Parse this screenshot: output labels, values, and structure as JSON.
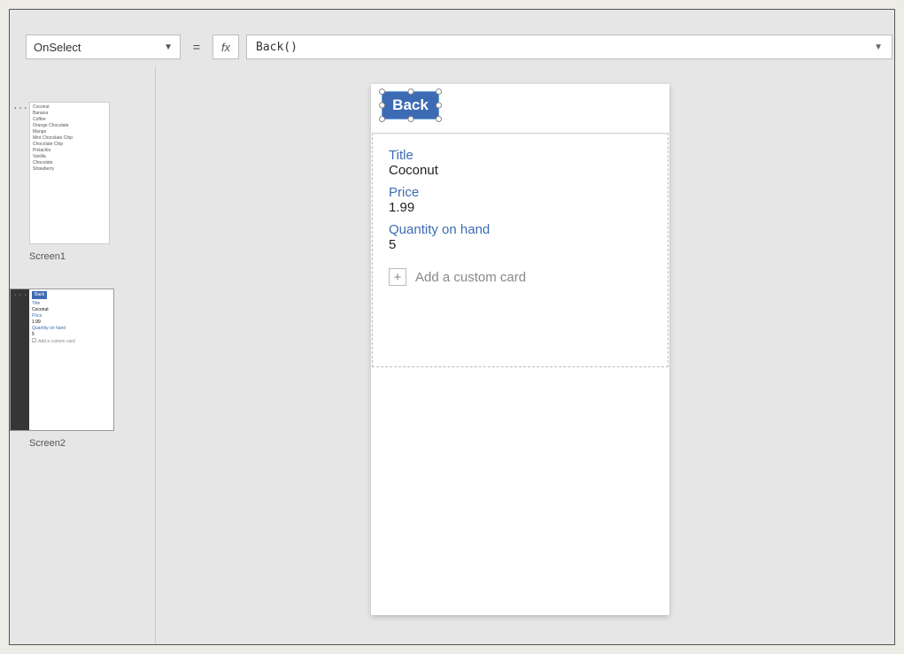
{
  "formula_bar": {
    "property": "OnSelect",
    "equals": "=",
    "fx": "fx",
    "formula": "Back()"
  },
  "thumbnails": {
    "screen1": {
      "label": "Screen1",
      "list": [
        "Coconut",
        "Banana",
        "Coffee",
        "Orange Chocolate",
        "Mango",
        "Mint Chocolate Chip",
        "Chocolate Chip",
        "Pistachio",
        "Vanilla",
        "Chocolate",
        "Strawberry"
      ]
    },
    "screen2": {
      "label": "Screen2",
      "back": "Back",
      "title_label": "Title",
      "title_value": "Coconut",
      "price_label": "Price",
      "price_value": "1.99",
      "qty_label": "Quantity on hand",
      "qty_value": "5",
      "add_card": "Add a custom card"
    }
  },
  "canvas": {
    "back_button": "Back",
    "fields": {
      "title_label": "Title",
      "title_value": "Coconut",
      "price_label": "Price",
      "price_value": "1.99",
      "qty_label": "Quantity on hand",
      "qty_value": "5"
    },
    "add_card": {
      "plus": "+",
      "text": "Add a custom card"
    }
  }
}
